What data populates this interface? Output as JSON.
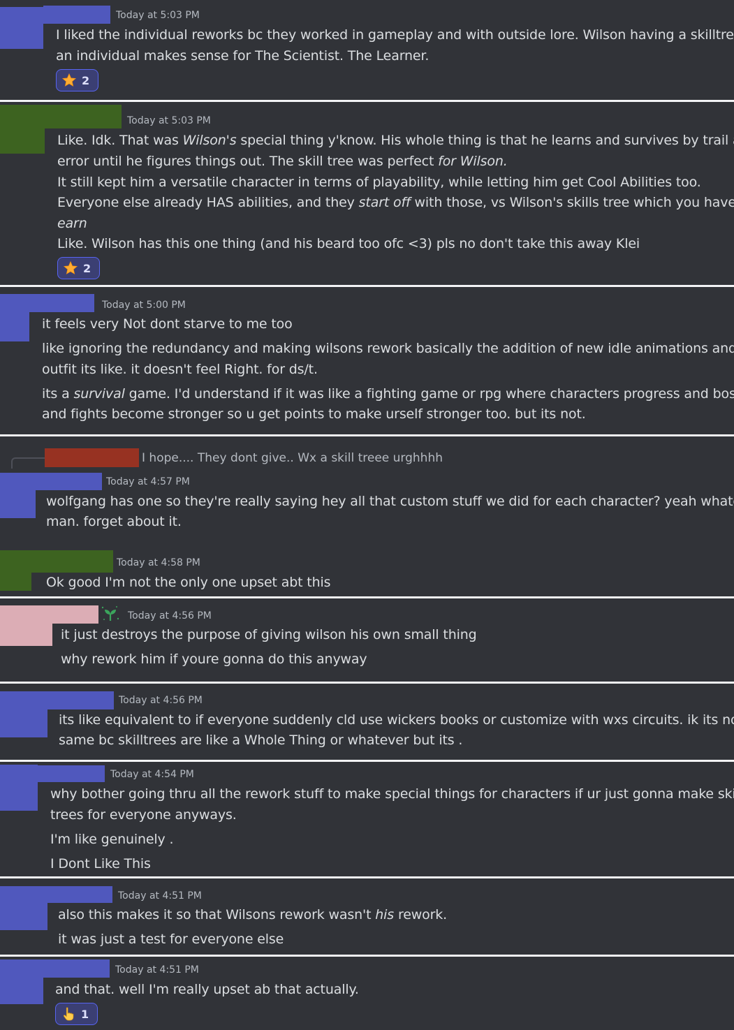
{
  "colors": {
    "background": "#313338",
    "separator": "#f2f3f5",
    "redact_blue": "#5058bd",
    "redact_green": "#3d6320",
    "redact_pink": "#dcadb5",
    "redact_red": "#973222",
    "reaction_border": "#5865f2"
  },
  "messages": [
    {
      "timestamp": "Today at 5:03 PM",
      "lines": [
        "I liked the individual reworks bc they worked in gameplay and with outside lore. Wilson having a skilltree as",
        "an individual  makes sense for The Scientist. The Learner."
      ],
      "reaction": {
        "icon": "star-icon",
        "count": "2"
      }
    },
    {
      "timestamp": "Today at 5:03 PM",
      "lines": {
        "l1_a": "Like. Idk. That was ",
        "l1_b": "Wilson's",
        "l1_c": " special thing y'know. His whole thing is that he learns and survives by trail and",
        "l2_a": "error until he figures things out. The skill tree was perfect ",
        "l2_b": "for Wilson.",
        "l3": "It still kept him a versatile character in terms of playability, while letting him get Cool Abilities too.",
        "l4_a": "Everyone else already HAS abilities, and they ",
        "l4_b": "start off",
        "l4_c": " with those, vs Wilson's skills tree which you have to",
        "l5": "earn",
        "l6": "Like. Wilson has this one thing (and his beard too ofc <3) pls no don't take this away Klei"
      },
      "reaction": {
        "icon": "star-icon",
        "count": "2"
      }
    },
    {
      "timestamp": "Today at 5:00 PM",
      "lines": {
        "l1": "it feels very Not dont starve to me too",
        "l2": "like ignoring the redundancy and making wilsons rework basically the addition of new idle animations and an",
        "l3": "outfit its like. it doesn't feel Right. for ds/t.",
        "l4_a": "its a ",
        "l4_b": "survival",
        "l4_c": " game. I'd understand if it was like a fighting game or rpg where characters progress and bosses",
        "l5": "and fights become stronger so u get points to make urself stronger too. but its not."
      }
    },
    {
      "reply_preview": "I hope.... They dont give.. Wx a skill treee urghhhh",
      "timestamp": "Today at 4:57 PM",
      "lines": [
        "wolfgang has one so they're really saying hey all that custom stuff we did for each character? yeah whatever",
        "man. forget about it."
      ]
    },
    {
      "timestamp": "Today at 4:58 PM",
      "lines": [
        "Ok good I'm not the only one upset abt this"
      ]
    },
    {
      "badge_icon": "sprout-icon",
      "timestamp": "Today at 4:56 PM",
      "lines": [
        "it just destroys the purpose of giving wilson his own small thing",
        "why rework him if youre gonna do this anyway"
      ]
    },
    {
      "timestamp": "Today at 4:56 PM",
      "lines": [
        "its like equivalent to if everyone suddenly cld use wickers books or customize with wxs circuits. ik its not th",
        "same bc skilltrees are like a Whole Thing or whatever but its ."
      ]
    },
    {
      "timestamp": "Today at 4:54 PM",
      "lines": [
        "why bother going thru all the rework stuff to make special things for characters if ur just gonna make skill",
        "trees for everyone anyways.",
        "I'm like genuinely .",
        "I Dont Like This"
      ]
    },
    {
      "timestamp": "Today at 4:51 PM",
      "lines": {
        "l1_a": "also this makes it so that Wilsons rework wasn't ",
        "l1_b": "his",
        "l1_c": " rework.",
        "l2": "it was just a test for everyone else"
      }
    },
    {
      "timestamp": "Today at 4:51 PM",
      "lines": [
        "and that. well I'm really upset ab that actually."
      ],
      "reaction": {
        "icon": "pointing-hand-icon",
        "count": "1"
      }
    }
  ]
}
